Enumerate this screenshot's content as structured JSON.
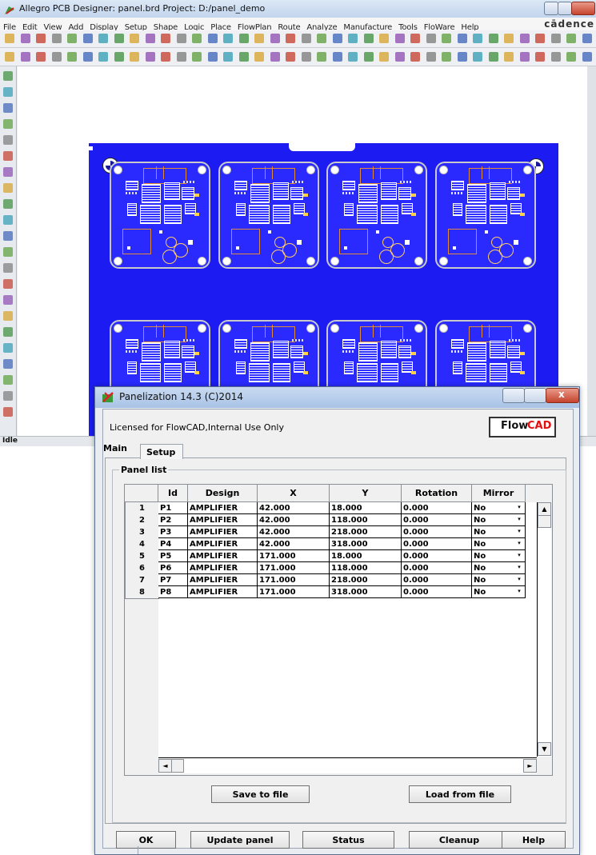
{
  "allegro": {
    "title": "Allegro PCB Designer: panel.brd  Project: D:/panel_demo",
    "menu": [
      "File",
      "Edit",
      "View",
      "Add",
      "Display",
      "Setup",
      "Shape",
      "Logic",
      "Place",
      "FlowPlan",
      "Route",
      "Analyze",
      "Manufacture",
      "Tools",
      "FloWare",
      "Help"
    ],
    "brand": "cādence",
    "status": "Idle",
    "colors": {
      "board": "#2a2aff",
      "panel": "#1c1cf2"
    }
  },
  "dialog": {
    "title": "Panelization 14.3 (C)2014",
    "license": "Licensed for FlowCAD,Internal Use Only",
    "logo": {
      "flow": "Flow",
      "cad": "CAD"
    },
    "tabs": {
      "main": "Main",
      "setup": "Setup"
    },
    "group_label": "Panel list",
    "columns": [
      "Id",
      "Design",
      "X",
      "Y",
      "Rotation",
      "Mirror"
    ],
    "rows": [
      {
        "n": "1",
        "id": "P1",
        "design": "AMPLIFIER",
        "x": "42.000",
        "y": "18.000",
        "rotation": "0.000",
        "mirror": "No"
      },
      {
        "n": "2",
        "id": "P2",
        "design": "AMPLIFIER",
        "x": "42.000",
        "y": "118.000",
        "rotation": "0.000",
        "mirror": "No"
      },
      {
        "n": "3",
        "id": "P3",
        "design": "AMPLIFIER",
        "x": "42.000",
        "y": "218.000",
        "rotation": "0.000",
        "mirror": "No"
      },
      {
        "n": "4",
        "id": "P4",
        "design": "AMPLIFIER",
        "x": "42.000",
        "y": "318.000",
        "rotation": "0.000",
        "mirror": "No"
      },
      {
        "n": "5",
        "id": "P5",
        "design": "AMPLIFIER",
        "x": "171.000",
        "y": "18.000",
        "rotation": "0.000",
        "mirror": "No"
      },
      {
        "n": "6",
        "id": "P6",
        "design": "AMPLIFIER",
        "x": "171.000",
        "y": "118.000",
        "rotation": "0.000",
        "mirror": "No"
      },
      {
        "n": "7",
        "id": "P7",
        "design": "AMPLIFIER",
        "x": "171.000",
        "y": "218.000",
        "rotation": "0.000",
        "mirror": "No"
      },
      {
        "n": "8",
        "id": "P8",
        "design": "AMPLIFIER",
        "x": "171.000",
        "y": "318.000",
        "rotation": "0.000",
        "mirror": "No"
      }
    ],
    "save_button": "Save to file",
    "load_button": "Load from file",
    "bottom_buttons": {
      "ok": "OK",
      "update": "Update panel",
      "status": "Status",
      "cleanup": "Cleanup",
      "help": "Help"
    },
    "icons": {
      "scroll_up": "▲",
      "scroll_down": "▼",
      "scroll_left": "◄",
      "scroll_right": "►",
      "dropdown": "▾"
    }
  }
}
